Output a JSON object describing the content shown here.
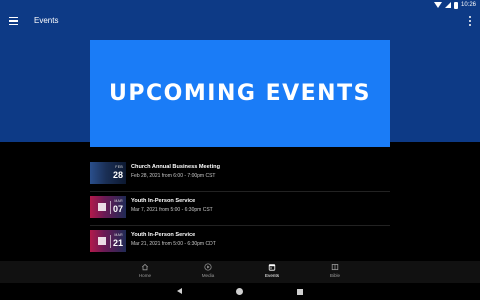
{
  "status_bar": {
    "time": "10:26"
  },
  "app_bar": {
    "title": "Events"
  },
  "banner": {
    "text": "UPCOMING EVENTS"
  },
  "events": [
    {
      "title": "Church Annual Business Meeting",
      "date": "Feb 28, 2021 from 6:00 - 7:00pm CST",
      "thumb_month": "FEB",
      "thumb_day": "28"
    },
    {
      "title": "Youth In-Person Service",
      "date": "Mar 7, 2021 from 5:00 - 6:30pm CST",
      "thumb_month": "MAR",
      "thumb_day": "07"
    },
    {
      "title": "Youth In-Person Service",
      "date": "Mar 21, 2021 from 5:00 - 6:30pm CDT",
      "thumb_month": "MAR",
      "thumb_day": "21"
    }
  ],
  "bottom_nav": [
    {
      "label": "Home",
      "icon": "home-icon"
    },
    {
      "label": "Media",
      "icon": "play-circle-icon"
    },
    {
      "label": "Events",
      "icon": "calendar-icon",
      "active": true
    },
    {
      "label": "Bible",
      "icon": "book-icon"
    }
  ],
  "colors": {
    "header": "#0d3a86",
    "banner": "#1a7cf7",
    "background": "#000000"
  }
}
